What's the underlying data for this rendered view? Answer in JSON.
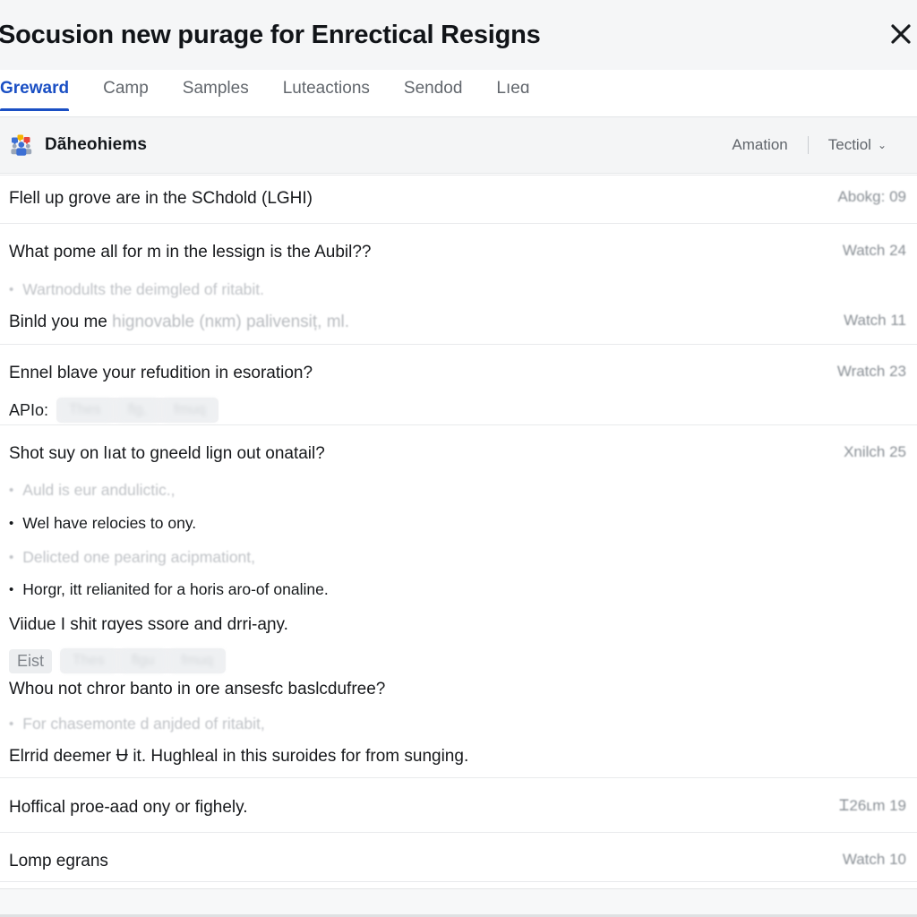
{
  "dialog": {
    "title": "Socusion new purage for Enrectical Resigns",
    "close_label": "×",
    "close_icon": "close-icon"
  },
  "tabs": [
    {
      "label": "Greward",
      "active": true
    },
    {
      "label": "Camp",
      "active": false
    },
    {
      "label": "Samples",
      "active": false
    },
    {
      "label": "Luteactions",
      "active": false
    },
    {
      "label": "Sendod",
      "active": false
    },
    {
      "label": "Lıeɑ",
      "active": false
    }
  ],
  "section": {
    "icon": "people-group-icon",
    "title": "Dãheohiems",
    "actions": [
      {
        "label": "Amation",
        "has_chevron": false
      },
      {
        "label": "Tectiol",
        "has_chevron": true,
        "chevron": "⌄"
      }
    ],
    "separator": "|"
  },
  "accent": {
    "tab_active": "#1a4fc4",
    "icon_blue": "#3c6fd4",
    "icon_red": "#e8453c",
    "icon_yellow": "#f5b400",
    "icon_green": "#34a853"
  },
  "rows": [
    {
      "type": "question",
      "text": "Flell up grove are in the SChdold (LGHI)",
      "meta": "Abokg: 09",
      "dim": false
    },
    {
      "type": "question",
      "text": "What pome all for m in the lessign is the Aubil??",
      "meta": "Watch 24",
      "dim": false
    },
    {
      "type": "bullet",
      "dot": "•",
      "text": "Wartnodults the deimgled of ritabit.",
      "tone": "light"
    },
    {
      "type": "question-mixed",
      "text": "Binld you me",
      "text_dim": "hignovable (nкm) palivensiț, ml.",
      "meta": "Watch 11"
    },
    {
      "type": "question",
      "text": "Ennel blave your refudition in esoration?",
      "meta": "Wratch 23",
      "dim": false
    },
    {
      "type": "tags",
      "label": "APIo:",
      "boxed": false,
      "chips": [
        "Thes",
        "flg,",
        "fmuq"
      ]
    },
    {
      "type": "question",
      "text": "Shot suy on lıat to gneeld lign out onatail?",
      "meta": "Xnilch 25",
      "dim": false
    },
    {
      "type": "bullet",
      "dot": "•",
      "text": "Auld is eur andulictic.,",
      "tone": "light"
    },
    {
      "type": "bullet",
      "dot": "•",
      "text": "Wel have relocies to ony.",
      "tone": "dark"
    },
    {
      "type": "bullet",
      "dot": "•",
      "text": "Delicted one pearing acipmationt,",
      "tone": "light"
    },
    {
      "type": "bullet",
      "dot": "•",
      "text": "Horgr, itt relianited for a horis aro-of onaline.",
      "tone": "dark"
    },
    {
      "type": "question",
      "text": "Viidue I shit rɑyes ssore and drri-aɲy.",
      "meta": "",
      "dim": false
    },
    {
      "type": "tags",
      "label": "Eist",
      "boxed": true,
      "chips": [
        "Thes",
        "flgu",
        "fmuq"
      ]
    },
    {
      "type": "question",
      "text": "Whou not chror banto in ore ansesfc baslcdufree?",
      "meta": "",
      "dim": false
    },
    {
      "type": "bullet",
      "dot": "•",
      "text": "For chasemonte d anjded of ritabit,",
      "tone": "light"
    },
    {
      "type": "question",
      "text": "Elrrid deemer Ʉ it. Hughleal in this suroides for from sunging.",
      "meta": "",
      "dim": false
    },
    {
      "type": "question",
      "text": "Hoffical proe-aad ony or fighely.",
      "meta": "Ꮖ26ʟm 19",
      "dim": false
    },
    {
      "type": "question",
      "text": "Lomp egrans",
      "meta": "Watch 10",
      "dim": false
    }
  ]
}
